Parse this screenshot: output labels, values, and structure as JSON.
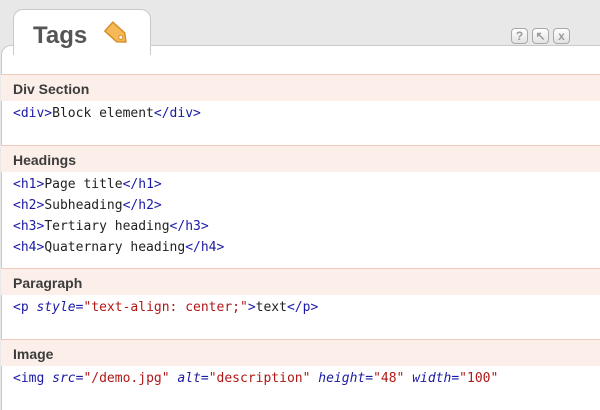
{
  "window": {
    "title": "Tags",
    "tab_icon": "tag-icon",
    "buttons": [
      {
        "name": "help-button",
        "icon": "help-icon",
        "glyph": "?"
      },
      {
        "name": "undock-button",
        "icon": "arrow-icon",
        "glyph": "↖"
      },
      {
        "name": "close-button",
        "icon": "close-icon",
        "glyph": "x"
      }
    ]
  },
  "colors": {
    "tag": "#1a1aa6",
    "attr_value": "#b01818",
    "section_header_bg": "#fcefea",
    "text": "#222222"
  },
  "sections": [
    {
      "title": "Div Section",
      "lines": [
        [
          {
            "t": "tag",
            "s": "<div>"
          },
          {
            "t": "text",
            "s": "Block element"
          },
          {
            "t": "tag",
            "s": "</div>"
          }
        ]
      ]
    },
    {
      "title": "Headings",
      "lines": [
        [
          {
            "t": "tag",
            "s": "<h1>"
          },
          {
            "t": "text",
            "s": "Page title"
          },
          {
            "t": "tag",
            "s": "</h1>"
          }
        ],
        [
          {
            "t": "tag",
            "s": "<h2>"
          },
          {
            "t": "text",
            "s": "Subheading"
          },
          {
            "t": "tag",
            "s": "</h2>"
          }
        ],
        [
          {
            "t": "tag",
            "s": "<h3>"
          },
          {
            "t": "text",
            "s": "Tertiary heading"
          },
          {
            "t": "tag",
            "s": "</h3>"
          }
        ],
        [
          {
            "t": "tag",
            "s": "<h4>"
          },
          {
            "t": "text",
            "s": "Quaternary heading"
          },
          {
            "t": "tag",
            "s": "</h4>"
          }
        ]
      ]
    },
    {
      "title": "Paragraph",
      "lines": [
        [
          {
            "t": "tag",
            "s": "<p "
          },
          {
            "t": "attr",
            "s": "style"
          },
          {
            "t": "tag",
            "s": "="
          },
          {
            "t": "val",
            "s": "\"text-align: center;\""
          },
          {
            "t": "tag",
            "s": ">"
          },
          {
            "t": "text",
            "s": "text"
          },
          {
            "t": "tag",
            "s": "</p>"
          }
        ]
      ]
    },
    {
      "title": "Image",
      "lines": [
        [
          {
            "t": "tag",
            "s": "<img "
          },
          {
            "t": "attr",
            "s": "src"
          },
          {
            "t": "tag",
            "s": "="
          },
          {
            "t": "val",
            "s": "\"/demo.jpg\""
          },
          {
            "t": "tag",
            "s": " "
          },
          {
            "t": "attr",
            "s": "alt"
          },
          {
            "t": "tag",
            "s": "="
          },
          {
            "t": "val",
            "s": "\"description\""
          },
          {
            "t": "tag",
            "s": " "
          },
          {
            "t": "attr",
            "s": "height"
          },
          {
            "t": "tag",
            "s": "="
          },
          {
            "t": "val",
            "s": "\"48\""
          },
          {
            "t": "tag",
            "s": " "
          },
          {
            "t": "attr",
            "s": "width"
          },
          {
            "t": "tag",
            "s": "="
          },
          {
            "t": "val",
            "s": "\"100\""
          }
        ]
      ]
    }
  ]
}
